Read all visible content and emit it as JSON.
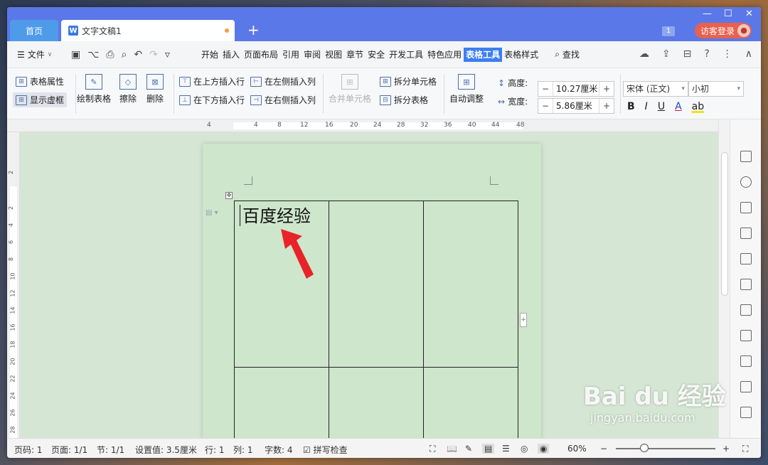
{
  "titlebar": {
    "home_tab": "首页",
    "doc_tab": "文字文稿1",
    "doc_icon": "W",
    "add_tab": "+",
    "badge": "1",
    "login": "访客登录",
    "minimize": "—",
    "maximize": "☐",
    "close": "✕"
  },
  "menubar": {
    "file": "文件",
    "items": [
      "开始",
      "插入",
      "页面布局",
      "引用",
      "审阅",
      "视图",
      "章节",
      "安全",
      "开发工具",
      "特色应用",
      "表格工具",
      "表格样式"
    ],
    "active_item": "表格工具",
    "find": "查找"
  },
  "ribbon": {
    "table_props": "表格属性",
    "show_gridlines": "显示虚框",
    "draw_table": "绘制表格",
    "erase": "擦除",
    "delete": "删除",
    "insert_above": "在上方插入行",
    "insert_below": "在下方插入行",
    "insert_left": "在左侧插入列",
    "insert_right": "在右侧插入列",
    "merge_cells": "合并单元格",
    "split_cells": "拆分单元格",
    "split_table": "拆分表格",
    "auto_fit": "自动调整",
    "height_label": "高度:",
    "height_value": "10.27厘米",
    "width_label": "宽度:",
    "width_value": "5.86厘米",
    "font_name": "宋体 (正文)",
    "font_size": "小初",
    "bold": "B",
    "italic": "I",
    "underline": "U",
    "font_color": "A",
    "highlight": "ab"
  },
  "ruler": {
    "h_ticks": [
      "4",
      "4",
      "8",
      "12",
      "16",
      "20",
      "24",
      "28",
      "32",
      "36",
      "40",
      "44",
      "48"
    ],
    "v_ticks": [
      "2",
      "2",
      "4",
      "6",
      "8",
      "10",
      "12",
      "14",
      "16",
      "18",
      "20",
      "22",
      "24",
      "26",
      "28"
    ]
  },
  "document": {
    "cell_text": "百度经验"
  },
  "statusbar": {
    "page_no": "页码: 1",
    "pages": "页面: 1/1",
    "section": "节: 1/1",
    "setting": "设置值: 3.5厘米",
    "row": "行: 1",
    "col": "列: 1",
    "word_count": "字数: 4",
    "spell_check": "拼写检查",
    "zoom": "60%"
  },
  "watermark": {
    "main": "Bai du 经验",
    "sub": "jingyan.baidu.com"
  },
  "colors": {
    "titlebar": "#5b78e8",
    "active_menu": "#3d7ef0",
    "page_bg": "#cee6cc",
    "arrow": "#e8232a"
  }
}
